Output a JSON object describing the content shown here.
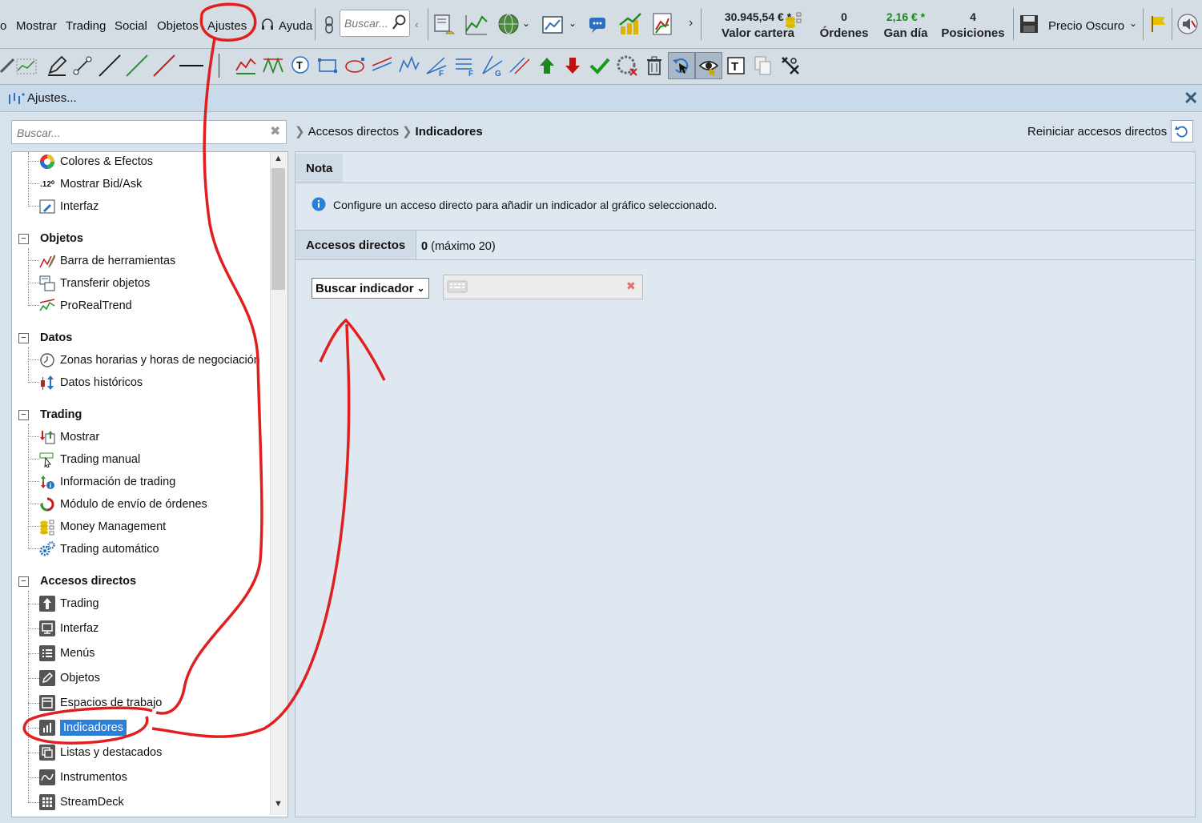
{
  "menubar": {
    "items": [
      "o",
      "Mostrar",
      "Trading",
      "Social",
      "Objetos",
      "Ajustes",
      "Ayuda"
    ],
    "search_placeholder": "Buscar...",
    "stats": [
      {
        "value": "30.945,54 € *",
        "label": "Valor cartera"
      },
      {
        "value": "0",
        "label": "Órdenes"
      },
      {
        "value": "2,16 € *",
        "label": "Gan día"
      },
      {
        "value": "4",
        "label": "Posiciones"
      }
    ],
    "price_mode": "Precio Oscuro",
    "colors": {
      "gain": "#1a8a1a"
    }
  },
  "dialog": {
    "title": "Ajustes...",
    "left_search_placeholder": "Buscar...",
    "tree": {
      "items_top": [
        "Colores & Efectos",
        "Mostrar Bid/Ask",
        "Interfaz"
      ],
      "sections": [
        {
          "title": "Objetos",
          "items": [
            "Barra de herramientas",
            "Transferir objetos",
            "ProRealTrend"
          ]
        },
        {
          "title": "Datos",
          "items": [
            "Zonas horarias y horas de negociación",
            "Datos históricos"
          ]
        },
        {
          "title": "Trading",
          "items": [
            "Mostrar",
            "Trading manual",
            "Información de trading",
            "Módulo de envío de órdenes",
            "Money Management",
            "Trading automático"
          ]
        },
        {
          "title": "Accesos directos",
          "items": [
            "Trading",
            "Interfaz",
            "Menús",
            "Objetos",
            "Espacios de trabajo",
            "Indicadores",
            "Listas y destacados",
            "Instrumentos",
            "StreamDeck"
          ]
        }
      ],
      "selected": "Indicadores"
    },
    "breadcrumb": {
      "parent": "Accesos directos",
      "current": "Indicadores"
    },
    "reset_label": "Reiniciar accesos directos",
    "note_tab": "Nota",
    "note_text": "Configure un acceso directo para añadir un indicador al gráfico seleccionado.",
    "shortcuts_tab": "Accesos directos",
    "shortcuts_count": "0",
    "shortcuts_max": "(máximo 20)",
    "search_indicator_label": "Buscar indicador"
  }
}
